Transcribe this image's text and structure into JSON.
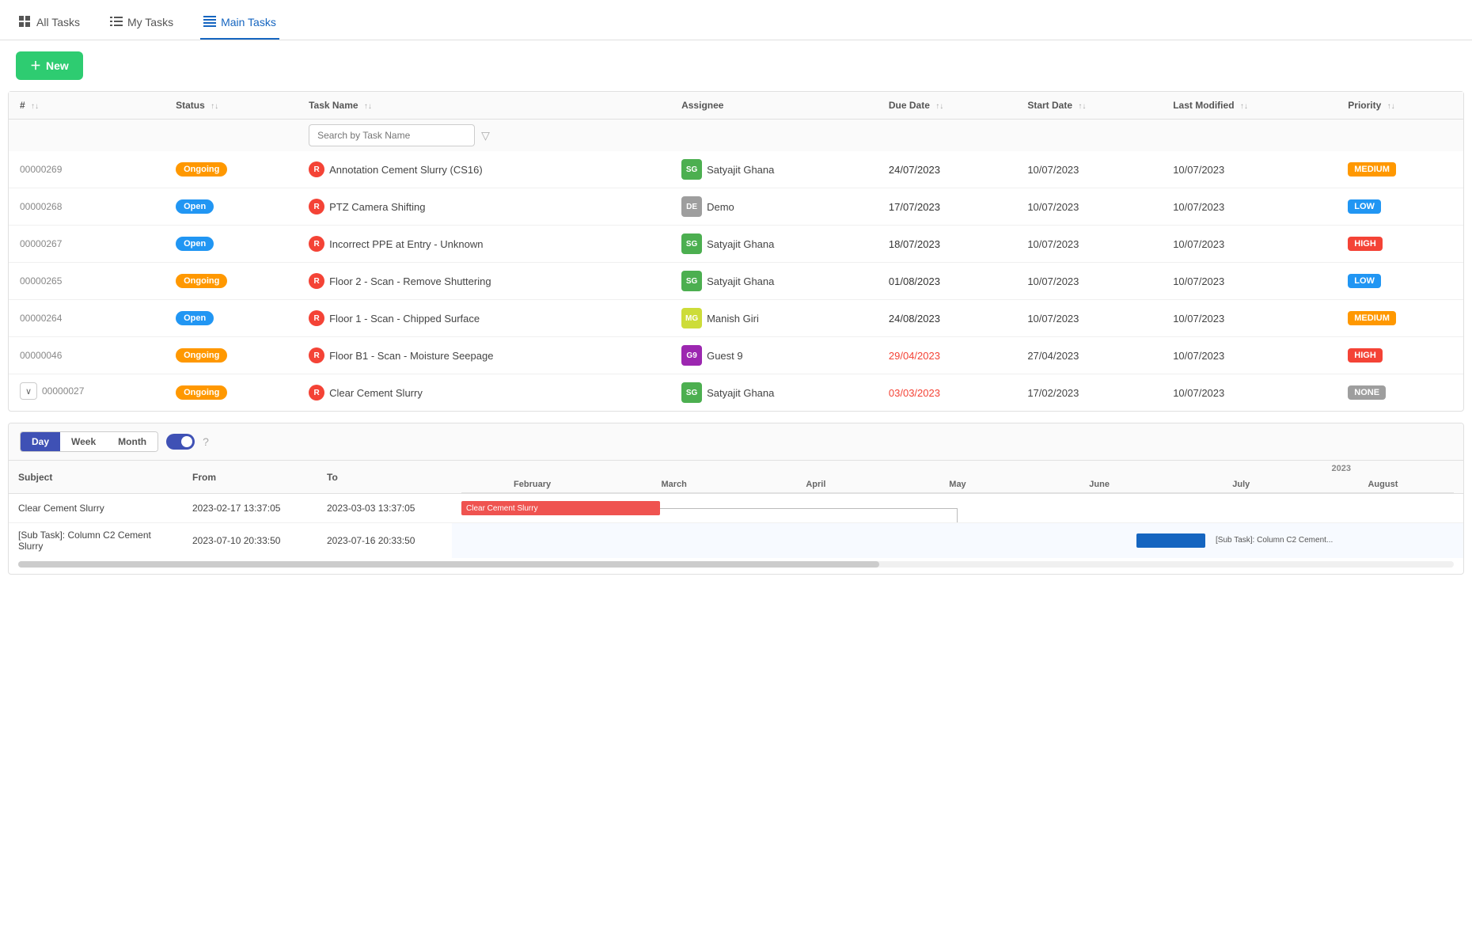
{
  "nav": {
    "tabs": [
      {
        "id": "all-tasks",
        "label": "All Tasks",
        "icon": "grid"
      },
      {
        "id": "my-tasks",
        "label": "My Tasks",
        "icon": "list"
      },
      {
        "id": "main-tasks",
        "label": "Main Tasks",
        "icon": "table",
        "active": true
      }
    ]
  },
  "toolbar": {
    "new_label": "+ New"
  },
  "table": {
    "columns": [
      {
        "id": "num",
        "label": "#",
        "sortable": true
      },
      {
        "id": "status",
        "label": "Status",
        "sortable": true
      },
      {
        "id": "task_name",
        "label": "Task Name",
        "sortable": true
      },
      {
        "id": "assignee",
        "label": "Assignee",
        "sortable": false
      },
      {
        "id": "due_date",
        "label": "Due Date",
        "sortable": true
      },
      {
        "id": "start_date",
        "label": "Start Date",
        "sortable": true
      },
      {
        "id": "last_modified",
        "label": "Last Modified",
        "sortable": true
      },
      {
        "id": "priority",
        "label": "Priority",
        "sortable": true
      }
    ],
    "search_placeholder": "Search by Task Name",
    "rows": [
      {
        "id": "00000269",
        "status": "Ongoing",
        "status_class": "badge-ongoing",
        "task_name": "Annotation Cement Slurry (CS16)",
        "assignee": "Satyajit Ghana",
        "assignee_initials": "SG",
        "assignee_class": "avatar-sg",
        "due_date": "24/07/2023",
        "due_date_class": "due-date-normal",
        "start_date": "10/07/2023",
        "last_modified": "10/07/2023",
        "priority": "MEDIUM",
        "priority_class": "priority-medium"
      },
      {
        "id": "00000268",
        "status": "Open",
        "status_class": "badge-open",
        "task_name": "PTZ Camera Shifting",
        "assignee": "Demo",
        "assignee_initials": "DE",
        "assignee_class": "avatar-de",
        "due_date": "17/07/2023",
        "due_date_class": "due-date-normal",
        "start_date": "10/07/2023",
        "last_modified": "10/07/2023",
        "priority": "LOW",
        "priority_class": "priority-low"
      },
      {
        "id": "00000267",
        "status": "Open",
        "status_class": "badge-open",
        "task_name": "Incorrect PPE at Entry - Unknown",
        "assignee": "Satyajit Ghana",
        "assignee_initials": "SG",
        "assignee_class": "avatar-sg",
        "due_date": "18/07/2023",
        "due_date_class": "due-date-normal",
        "start_date": "10/07/2023",
        "last_modified": "10/07/2023",
        "priority": "HIGH",
        "priority_class": "priority-high"
      },
      {
        "id": "00000265",
        "status": "Ongoing",
        "status_class": "badge-ongoing",
        "task_name": "Floor 2 - Scan - Remove Shuttering",
        "assignee": "Satyajit Ghana",
        "assignee_initials": "SG",
        "assignee_class": "avatar-sg",
        "due_date": "01/08/2023",
        "due_date_class": "due-date-normal",
        "start_date": "10/07/2023",
        "last_modified": "10/07/2023",
        "priority": "LOW",
        "priority_class": "priority-low"
      },
      {
        "id": "00000264",
        "status": "Open",
        "status_class": "badge-open",
        "task_name": "Floor 1 - Scan - Chipped Surface",
        "assignee": "Manish Giri",
        "assignee_initials": "MG",
        "assignee_class": "avatar-mg",
        "due_date": "24/08/2023",
        "due_date_class": "due-date-normal",
        "start_date": "10/07/2023",
        "last_modified": "10/07/2023",
        "priority": "MEDIUM",
        "priority_class": "priority-medium"
      },
      {
        "id": "00000046",
        "status": "Ongoing",
        "status_class": "badge-ongoing",
        "task_name": "Floor B1 - Scan - Moisture Seepage",
        "assignee": "Guest 9",
        "assignee_initials": "G9",
        "assignee_class": "avatar-g9",
        "due_date": "29/04/2023",
        "due_date_class": "due-date-overdue",
        "start_date": "27/04/2023",
        "last_modified": "10/07/2023",
        "priority": "HIGH",
        "priority_class": "priority-high"
      },
      {
        "id": "00000027",
        "status": "Ongoing",
        "status_class": "badge-ongoing",
        "task_name": "Clear Cement Slurry",
        "assignee": "Satyajit Ghana",
        "assignee_initials": "SG",
        "assignee_class": "avatar-sg",
        "due_date": "03/03/2023",
        "due_date_class": "due-date-overdue",
        "start_date": "17/02/2023",
        "last_modified": "10/07/2023",
        "priority": "NONE",
        "priority_class": "priority-none",
        "expandable": true
      }
    ]
  },
  "gantt": {
    "controls": {
      "day_label": "Day",
      "week_label": "Week",
      "month_label": "Month",
      "active": "Day"
    },
    "columns": [
      {
        "label": "Subject"
      },
      {
        "label": "From"
      },
      {
        "label": "To"
      }
    ],
    "year_label": "2023",
    "months": [
      "February",
      "March",
      "April",
      "May",
      "June",
      "July",
      "August"
    ],
    "rows": [
      {
        "subject": "Clear Cement Slurry",
        "from": "2023-02-17 13:37:05",
        "to": "2023-03-03 13:37:05",
        "bar_label": "Clear Cement Slurry"
      },
      {
        "subject": "[Sub Task]: Column C2 Cement Slurry",
        "from": "2023-07-10 20:33:50",
        "to": "2023-07-16 20:33:50",
        "bar_label": "[Sub Task]: Column C2 Cement..."
      }
    ]
  }
}
